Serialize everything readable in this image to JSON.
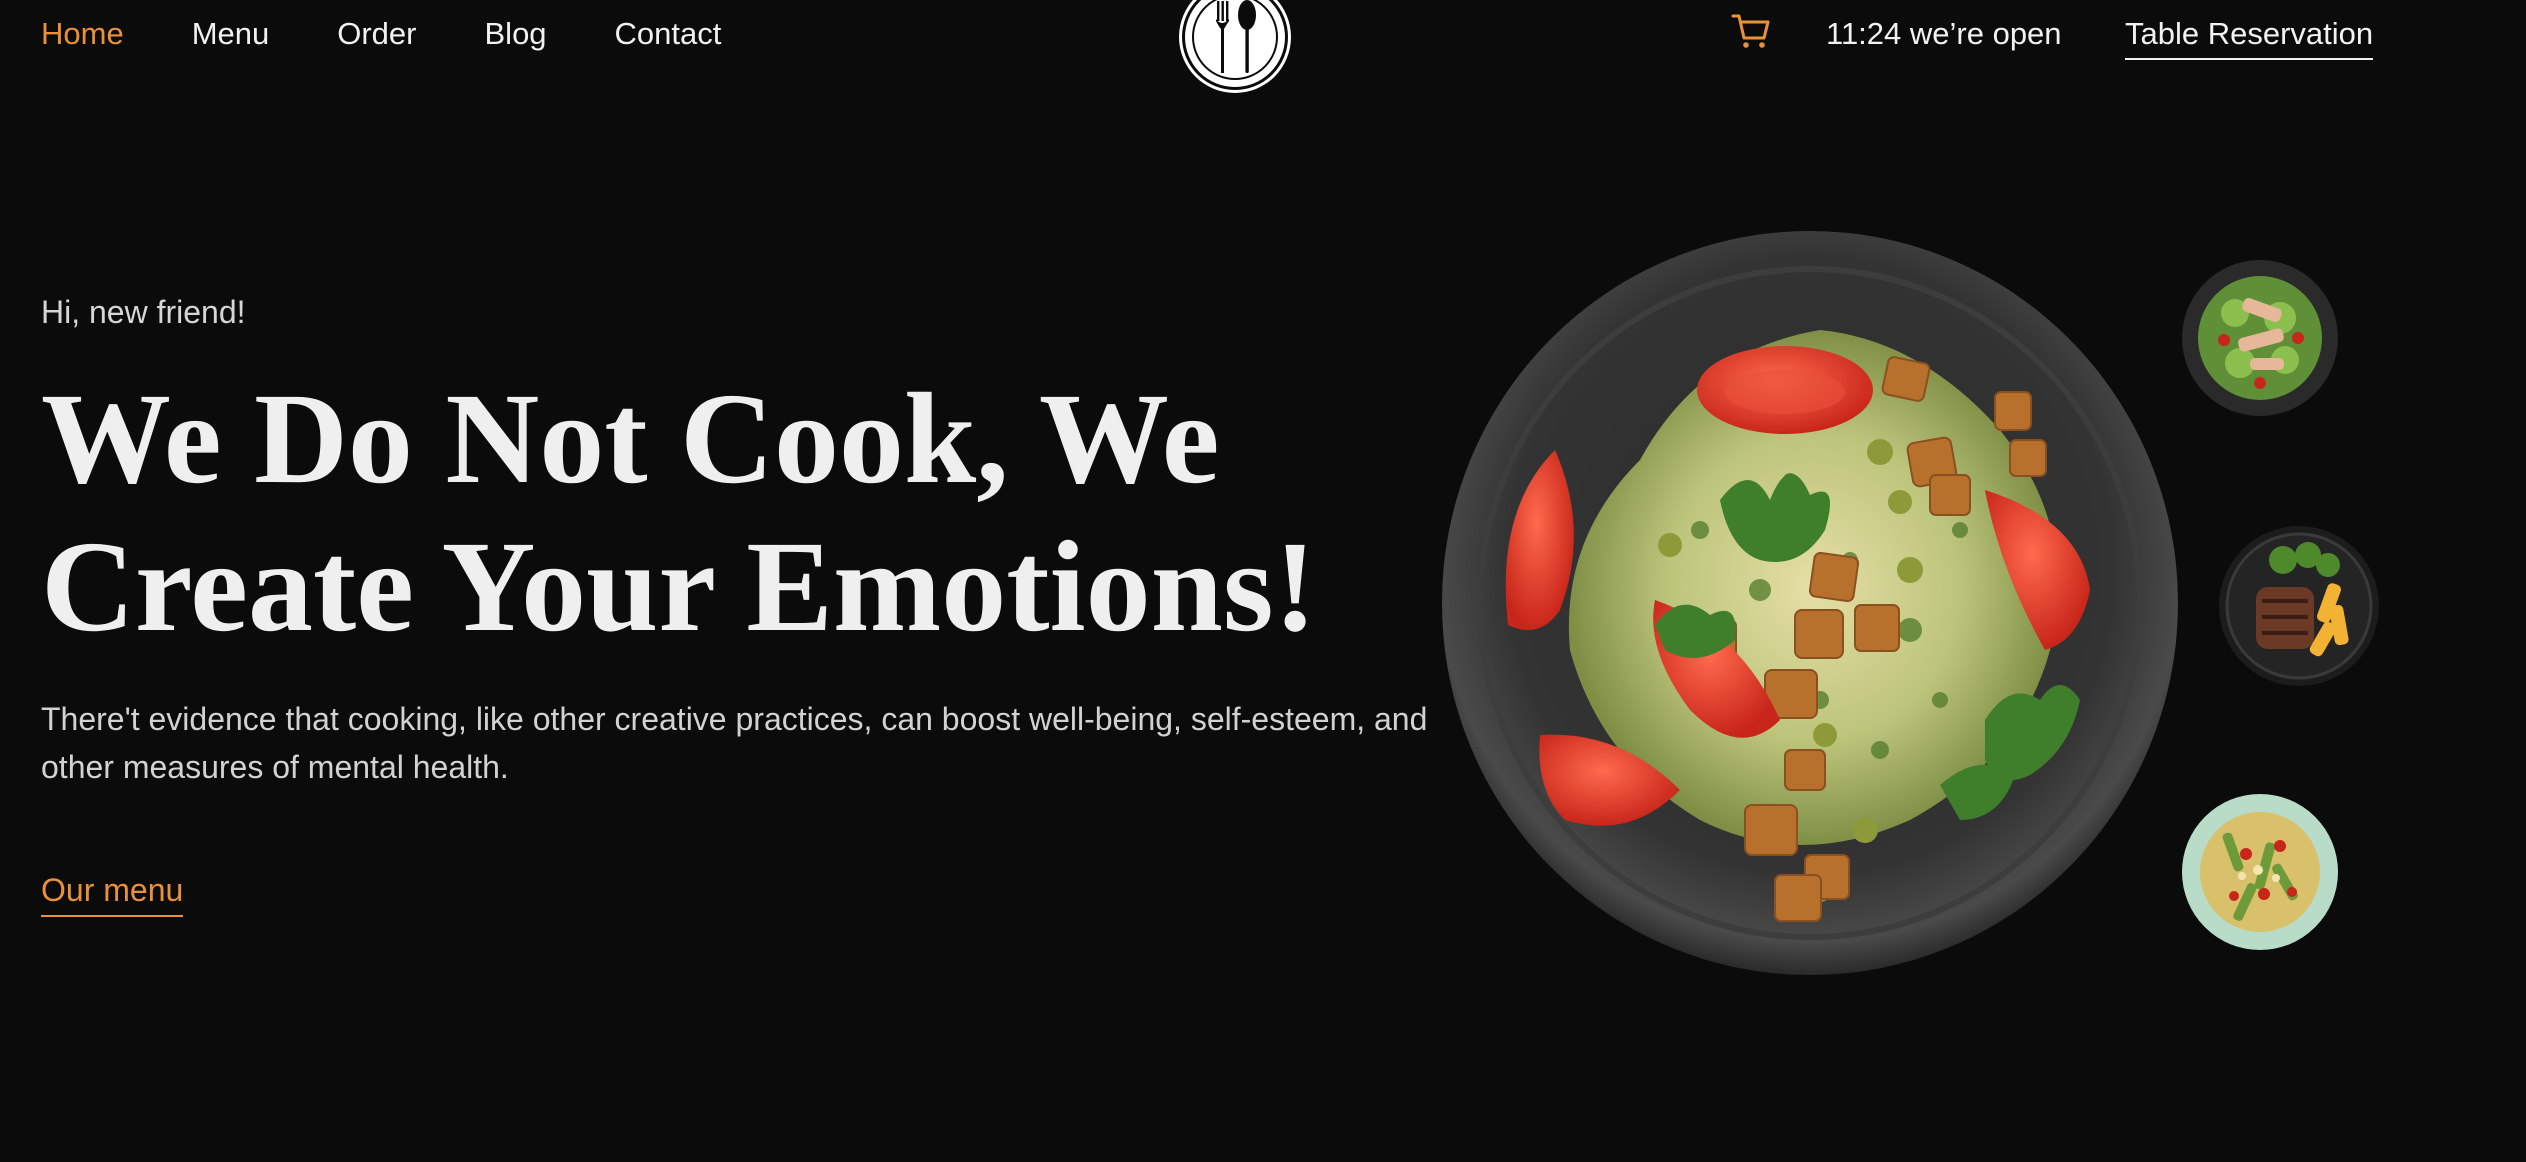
{
  "nav": {
    "links": [
      {
        "label": "Home",
        "active": true
      },
      {
        "label": "Menu",
        "active": false
      },
      {
        "label": "Order",
        "active": false
      },
      {
        "label": "Blog",
        "active": false
      },
      {
        "label": "Contact",
        "active": false
      }
    ],
    "logo_icon": "fork-spoon-icon",
    "cart_icon": "cart-icon",
    "status": "11:24 we’re open",
    "reservation": "Table Reservation"
  },
  "hero": {
    "greeting": "Hi, new friend!",
    "headline_line1": "We Do Not Cook, We",
    "headline_line2": "Create Your Emotions!",
    "description": "There't evidence that cooking, like other creative practices, can boost well-being, self-esteem, and other measures of mental health.",
    "cta": "Our menu"
  },
  "dishes": {
    "main": "salad-plate-image",
    "thumbnails": [
      "chicken-salad-thumbnail",
      "steak-plate-thumbnail",
      "pasta-salad-thumbnail"
    ]
  },
  "colors": {
    "background": "#0b0b0b",
    "accent": "#e8913a",
    "text": "#f2f2f2"
  }
}
